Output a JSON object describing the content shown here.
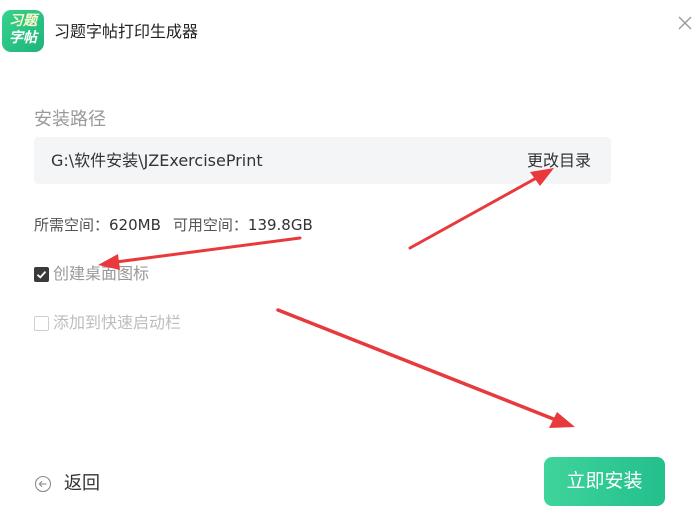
{
  "header": {
    "logo_line1": "习题",
    "logo_line2": "字帖",
    "title": "习题字帖打印生成器",
    "close_icon": "close-icon"
  },
  "install_path": {
    "label": "安装路径",
    "value": "G:\\软件安装\\JZExercisePrint",
    "change_label": "更改目录"
  },
  "space": {
    "required_label": "所需空间：",
    "required_value": "620MB",
    "available_label": "可用空间：",
    "available_value": "139.8GB"
  },
  "options": [
    {
      "label": "创建桌面图标",
      "checked": true
    },
    {
      "label": "添加到快速启动栏",
      "checked": false
    }
  ],
  "footer": {
    "back_label": "返回",
    "install_label": "立即安装"
  },
  "colors": {
    "accent": "#2cc691",
    "annotation_arrow": "#e8393c"
  }
}
